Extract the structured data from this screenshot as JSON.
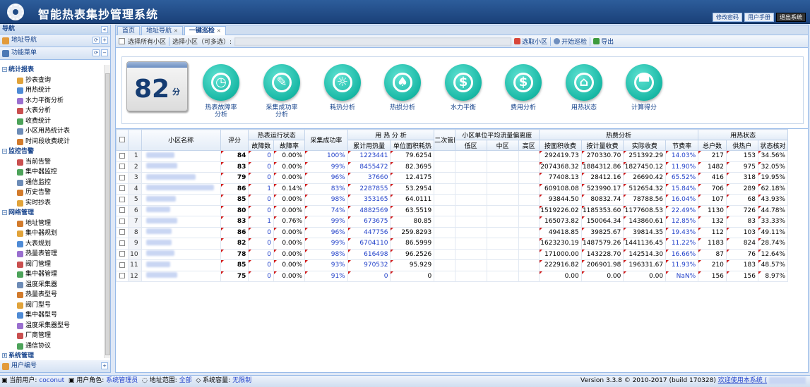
{
  "app": {
    "title": "智能热表集抄管理系统"
  },
  "header_buttons": [
    "修改密码",
    "用户手册",
    "退出系统"
  ],
  "sidebar": {
    "nav_title": "导航",
    "accordions": [
      {
        "label": "地址导航"
      },
      {
        "label": "功能菜单"
      }
    ],
    "groups": [
      {
        "label": "统计报表",
        "items": [
          "抄表查询",
          "用热统计",
          "水力平衡分析",
          "大表分析",
          "收费统计",
          "小区用热统计表",
          "时间段收费统计"
        ]
      },
      {
        "label": "监控告警",
        "items": [
          "当前告警",
          "集中器监控",
          "通信监控",
          "历史告警",
          "实时抄表"
        ]
      },
      {
        "label": "网络管理",
        "items": [
          "地址管理",
          "集中器规划",
          "大表规划",
          "热量表管理",
          "阀门管理",
          "集中器管理",
          "温度采集器",
          "热量表型号",
          "阀门型号",
          "集中器型号",
          "温度采集器型号",
          "厂商管理",
          "通信协议"
        ]
      },
      {
        "label": "系统管理",
        "items": []
      }
    ],
    "bottom_accordion": "用户编号"
  },
  "tabs": [
    {
      "label": "首页"
    },
    {
      "label": "地址导航"
    },
    {
      "label": "一键巡检",
      "active": true
    }
  ],
  "toolbar": {
    "select_all": "选择所有小区",
    "select_label": "选择小区（可多选）:",
    "btn_select": "选取小区",
    "btn_start": "开始巡检",
    "btn_export": "导出"
  },
  "dashboard": {
    "score": "82",
    "score_unit": "分",
    "modules": [
      {
        "label": "热表故障率\n分析",
        "icon": "stopwatch-icon",
        "glyph": "◷"
      },
      {
        "label": "采集成功率\n分析",
        "icon": "document-icon",
        "glyph": "✎"
      },
      {
        "label": "耗热分析",
        "icon": "sun-icon",
        "glyph": "☼"
      },
      {
        "label": "热损分析",
        "icon": "broom-icon",
        "glyph": "♠"
      },
      {
        "label": "水力平衡",
        "icon": "dollar-icon",
        "glyph": "$"
      },
      {
        "label": "费用分析",
        "icon": "dollar-icon",
        "glyph": "$"
      },
      {
        "label": "用热状态",
        "icon": "home-icon",
        "glyph": "⌂"
      },
      {
        "label": "计算得分",
        "icon": "paint-roller-icon",
        "glyph": "▀"
      }
    ]
  },
  "table": {
    "group_headers": {
      "name": "小区名称",
      "score": "评分",
      "meter_status": "热表运行状态",
      "success": "采集成功率",
      "heat": "用 热 分 析",
      "second": "二次管网热损",
      "flow": "小区单位平均流量偏离度",
      "fee": "热费分析",
      "usage": "用热状态"
    },
    "sub_headers": {
      "faults": "故障数",
      "fault_rate": "故障率",
      "total_heat": "累计用热量",
      "unit_heat": "单位面积耗热",
      "low": "低区",
      "mid": "中区",
      "high": "高区",
      "area_fee": "按面积收费",
      "meter_fee": "按计量收费",
      "actual_fee": "实际收费",
      "save_rate": "节费率",
      "total_users": "总户数",
      "heating": "供热户",
      "status_check": "状态核对"
    },
    "rows": [
      {
        "n": "1",
        "score": "84",
        "faults": "0",
        "fault_rate": "0.00%",
        "success": "100%",
        "total_heat": "1223441",
        "unit_heat": "79.6254",
        "area_fee": "292419.73",
        "meter_fee": "270330.70",
        "actual_fee": "251392.29",
        "save_rate": "14.03%",
        "total_users": "217",
        "heating": "153",
        "status_check": "34.56%"
      },
      {
        "n": "2",
        "score": "83",
        "faults": "0",
        "fault_rate": "0.00%",
        "success": "99%",
        "total_heat": "8455472",
        "unit_heat": "82.3695",
        "area_fee": "2074368.32",
        "meter_fee": "1884312.86",
        "actual_fee": "1827450.12",
        "save_rate": "11.90%",
        "total_users": "1482",
        "heating": "975",
        "status_check": "32.05%"
      },
      {
        "n": "3",
        "score": "79",
        "faults": "0",
        "fault_rate": "0.00%",
        "success": "96%",
        "total_heat": "37660",
        "unit_heat": "12.4175",
        "area_fee": "77408.13",
        "meter_fee": "28412.16",
        "actual_fee": "26690.42",
        "save_rate": "65.52%",
        "total_users": "416",
        "heating": "318",
        "status_check": "19.95%"
      },
      {
        "n": "4",
        "score": "86",
        "faults": "1",
        "fault_rate": "0.14%",
        "success": "83%",
        "total_heat": "2287855",
        "unit_heat": "53.2954",
        "area_fee": "609108.08",
        "meter_fee": "523990.17",
        "actual_fee": "512654.32",
        "save_rate": "15.84%",
        "total_users": "706",
        "heating": "289",
        "status_check": "62.18%"
      },
      {
        "n": "5",
        "score": "85",
        "faults": "0",
        "fault_rate": "0.00%",
        "success": "98%",
        "total_heat": "353165",
        "unit_heat": "64.0111",
        "area_fee": "93844.50",
        "meter_fee": "80832.74",
        "actual_fee": "78788.56",
        "save_rate": "16.04%",
        "total_users": "107",
        "heating": "68",
        "status_check": "43.93%"
      },
      {
        "n": "6",
        "score": "80",
        "faults": "0",
        "fault_rate": "0.00%",
        "success": "74%",
        "total_heat": "4882569",
        "unit_heat": "63.5519",
        "area_fee": "1519226.02",
        "meter_fee": "1185353.60",
        "actual_fee": "1177608.53",
        "save_rate": "22.49%",
        "total_users": "1130",
        "heating": "726",
        "status_check": "44.78%"
      },
      {
        "n": "7",
        "score": "83",
        "faults": "1",
        "fault_rate": "0.76%",
        "success": "99%",
        "total_heat": "673675",
        "unit_heat": "80.85",
        "area_fee": "165073.82",
        "meter_fee": "150064.34",
        "actual_fee": "143860.61",
        "save_rate": "12.85%",
        "total_users": "132",
        "heating": "83",
        "status_check": "33.33%"
      },
      {
        "n": "8",
        "score": "86",
        "faults": "0",
        "fault_rate": "0.00%",
        "success": "96%",
        "total_heat": "447756",
        "unit_heat": "259.8293",
        "area_fee": "49418.85",
        "meter_fee": "39825.67",
        "actual_fee": "39814.35",
        "save_rate": "19.43%",
        "total_users": "112",
        "heating": "103",
        "status_check": "49.11%"
      },
      {
        "n": "9",
        "score": "82",
        "faults": "0",
        "fault_rate": "0.00%",
        "success": "99%",
        "total_heat": "6704110",
        "unit_heat": "86.5999",
        "area_fee": "1623230.19",
        "meter_fee": "1487579.26",
        "actual_fee": "1441136.45",
        "save_rate": "11.22%",
        "total_users": "1183",
        "heating": "824",
        "status_check": "28.74%"
      },
      {
        "n": "10",
        "score": "78",
        "faults": "0",
        "fault_rate": "0.00%",
        "success": "98%",
        "total_heat": "616498",
        "unit_heat": "96.2526",
        "area_fee": "171000.00",
        "meter_fee": "143228.70",
        "actual_fee": "142514.30",
        "save_rate": "16.66%",
        "total_users": "87",
        "heating": "76",
        "status_check": "12.64%"
      },
      {
        "n": "11",
        "score": "85",
        "faults": "0",
        "fault_rate": "0.00%",
        "success": "93%",
        "total_heat": "970532",
        "unit_heat": "95.929",
        "area_fee": "222916.82",
        "meter_fee": "206901.98",
        "actual_fee": "196331.67",
        "save_rate": "11.93%",
        "total_users": "210",
        "heating": "183",
        "status_check": "48.57%"
      },
      {
        "n": "12",
        "score": "75",
        "faults": "0",
        "fault_rate": "0.00%",
        "success": "91%",
        "total_heat": "0",
        "unit_heat": "0",
        "area_fee": "0.00",
        "meter_fee": "0.00",
        "actual_fee": "0.00",
        "save_rate": "NaN%",
        "total_users": "156",
        "heating": "156",
        "status_check": "8.97%"
      }
    ]
  },
  "status": {
    "user_label": "当前用户:",
    "user": "coconut",
    "role_label": "用户角色:",
    "role": "系统管理员",
    "scope_label": "地址范围:",
    "scope": "全部",
    "capacity_label": "系统容量:",
    "capacity": "无限制",
    "version": "Version 3.3.8 © 2010-2017  (build 170328)",
    "welcome": "欢迎使用本系统 ("
  }
}
